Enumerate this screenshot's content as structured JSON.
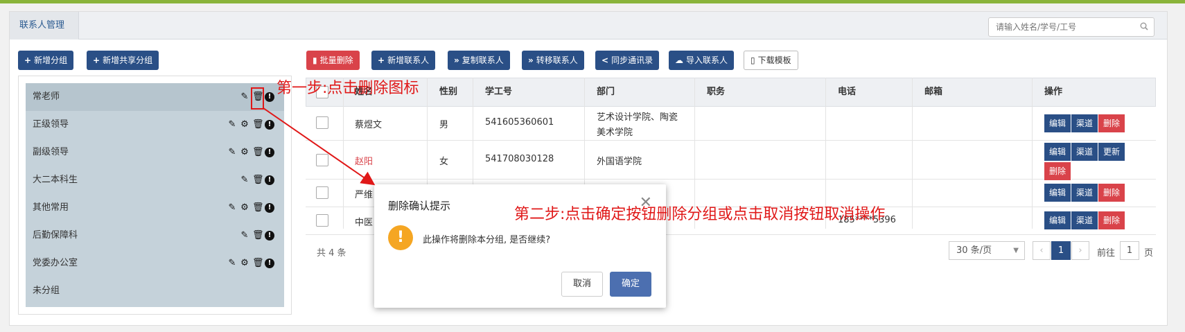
{
  "tab": {
    "label": "联系人管理"
  },
  "search": {
    "placeholder": "请输入姓名/学号/工号"
  },
  "left_buttons": {
    "add_group": "新增分组",
    "add_shared_group": "新增共享分组"
  },
  "toolbar": {
    "batch_delete": "批量删除",
    "add_contact": "新增联系人",
    "copy_contact": "复制联系人",
    "transfer_contact": "转移联系人",
    "sync_contacts": "同步通讯录",
    "import_contact": "导入联系人",
    "download_template": "下载模板"
  },
  "groups": [
    {
      "name": "常老师"
    },
    {
      "name": "正级领导"
    },
    {
      "name": "副级领导"
    },
    {
      "name": "大二本科生"
    },
    {
      "name": "其他常用"
    },
    {
      "name": "后勤保障科"
    },
    {
      "name": "党委办公室"
    },
    {
      "name": "未分组"
    }
  ],
  "table": {
    "headers": {
      "name": "姓名",
      "gender": "性别",
      "id": "学工号",
      "dept": "部门",
      "position": "职务",
      "phone": "电话",
      "email": "邮箱",
      "actions": "操作"
    },
    "rows": [
      {
        "name": "蔡煜文",
        "gender": "男",
        "id": "541605360601",
        "dept_line1": "艺术设计学院、陶瓷",
        "dept_line2": "美术学院",
        "phone": "",
        "email": ""
      },
      {
        "name": "赵阳",
        "gender": "女",
        "id": "541708030128",
        "dept_line1": "外国语学院",
        "dept_line2": "",
        "phone": "",
        "email": ""
      },
      {
        "name": "严维",
        "gender": "",
        "id": "",
        "dept_line1": "",
        "dept_line2": "",
        "phone": "",
        "email": ""
      },
      {
        "name": "中医",
        "gender": "",
        "id": "",
        "dept_line1": "",
        "dept_line2": "",
        "phone": "185****5396",
        "email": ""
      }
    ],
    "ops": {
      "edit": "编辑",
      "channel": "渠道",
      "delete": "删除",
      "update": "更新"
    }
  },
  "footer": {
    "total": "共 4 条",
    "page_size": "30 条/页",
    "current_page": "1",
    "goto_label": "前往",
    "goto_value": "1",
    "page_suffix": "页",
    "prev": "‹",
    "next": "›"
  },
  "dialog": {
    "title": "删除确认提示",
    "message": "此操作将删除本分组, 是否继续?",
    "cancel": "取消",
    "confirm": "确定",
    "close": "✕"
  },
  "annotations": {
    "step1": "第一步:点击删除图标",
    "step2": "第二步:点击确定按钮删除分组或点击取消按钮取消操作"
  },
  "colors": {
    "accent": "#2a4f86",
    "danger": "#d9434a",
    "annotation": "#e01818",
    "warning": "#f5a623"
  }
}
